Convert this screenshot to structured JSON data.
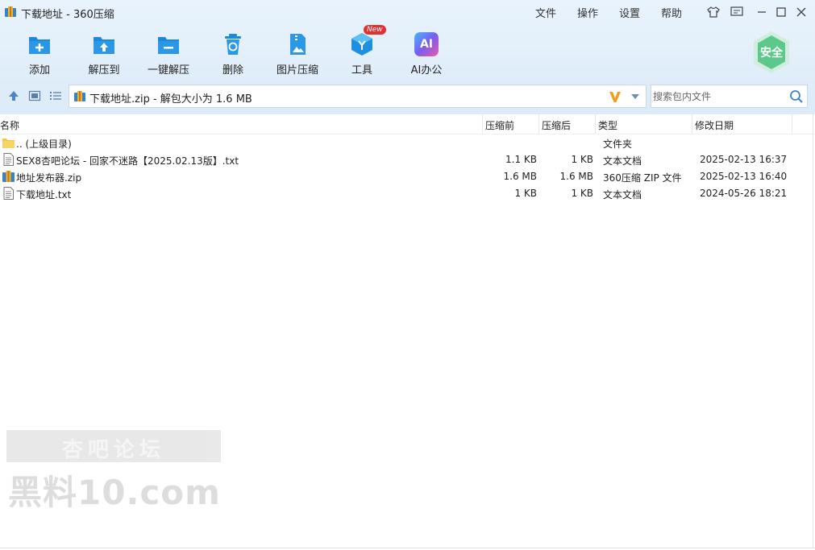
{
  "window": {
    "title": "下载地址 - 360压缩"
  },
  "menu": {
    "file": "文件",
    "edit": "操作",
    "settings": "设置",
    "help": "帮助"
  },
  "toolbar": {
    "add": "添加",
    "extract_to": "解压到",
    "one_click_extract": "一键解压",
    "delete": "删除",
    "image_compress": "图片压缩",
    "tools": "工具",
    "tools_badge": "New",
    "ai_office": "AI办公",
    "ai_icon_text": "AI",
    "safe": "安全"
  },
  "address": {
    "path": "下载地址.zip - 解包大小为 1.6 MB"
  },
  "search": {
    "placeholder": "搜索包内文件"
  },
  "columns": {
    "name": "名称",
    "compressed": "压缩前",
    "uncompressed": "压缩后",
    "type": "类型",
    "modified": "修改日期"
  },
  "files": [
    {
      "name": ".. (上级目录)",
      "before": "",
      "after": "",
      "type": "文件夹",
      "date": "",
      "icon": "folder-icon"
    },
    {
      "name": "SEX8杏吧论坛 - 回家不迷路【2025.02.13版】.txt",
      "before": "1.1 KB",
      "after": "1 KB",
      "type": "文本文档",
      "date": "2025-02-13 16:37",
      "icon": "text-file-icon"
    },
    {
      "name": "地址发布器.zip",
      "before": "1.6 MB",
      "after": "1.6 MB",
      "type": "360压缩 ZIP 文件",
      "date": "2025-02-13 16:40",
      "icon": "zip-file-icon"
    },
    {
      "name": "下载地址.txt",
      "before": "1 KB",
      "after": "1 KB",
      "type": "文本文档",
      "date": "2024-05-26 18:21",
      "icon": "text-file-icon"
    }
  ],
  "watermark": {
    "line1": "杏吧论坛",
    "line2": "黑料10.com"
  },
  "colors": {
    "accent": "#1a8cd8",
    "toolbar_bg": "#e3eff9",
    "safe_green": "#5cc98a"
  }
}
